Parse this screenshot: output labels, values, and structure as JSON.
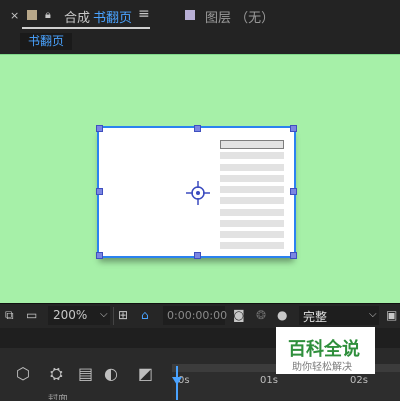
{
  "tabs": {
    "close": "×",
    "comp_label": "合成",
    "comp_name": "书翻页",
    "menu": "≡",
    "layer_label": "图层 （无）"
  },
  "breadcrumb": {
    "label": "书翻页"
  },
  "toolbar": {
    "zoom": "200%",
    "timecode": "0:00:00:00",
    "resolution": "完整"
  },
  "timeline": {
    "ticks": [
      "0s",
      "01s",
      "02s"
    ],
    "layer_label": "封面"
  },
  "watermark": {
    "title": "百科全说",
    "subtitle": "助你轻松解决"
  },
  "colors": {
    "accent": "#4aa3ff",
    "viewer_bg": "#a6f0a8",
    "selection": "#2b82f0",
    "handle": "#7b86e2"
  }
}
